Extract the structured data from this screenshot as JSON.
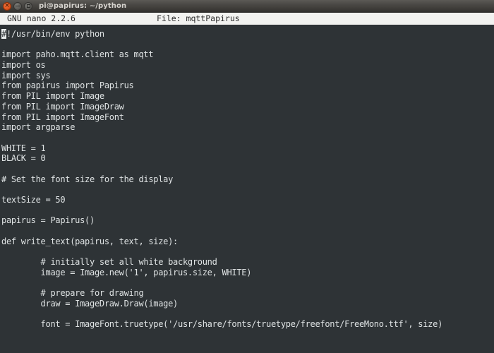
{
  "window": {
    "title": "pi@papirus: ~/python",
    "buttons": [
      {
        "name": "close",
        "glyph": "×"
      },
      {
        "name": "minimize",
        "glyph": "−"
      },
      {
        "name": "maximize",
        "glyph": "□"
      }
    ]
  },
  "nano": {
    "version_label": "GNU nano 2.2.6",
    "file_label": "File: mqttPapirus"
  },
  "editor": {
    "cursor": {
      "line": 0,
      "column": 0,
      "char": "#"
    },
    "lines": [
      "#!/usr/bin/env python",
      "",
      "import paho.mqtt.client as mqtt",
      "import os",
      "import sys",
      "from papirus import Papirus",
      "from PIL import Image",
      "from PIL import ImageDraw",
      "from PIL import ImageFont",
      "import argparse",
      "",
      "WHITE = 1",
      "BLACK = 0",
      "",
      "# Set the font size for the display",
      "",
      "textSize = 50",
      "",
      "papirus = Papirus()",
      "",
      "def write_text(papirus, text, size):",
      "",
      "        # initially set all white background",
      "        image = Image.new('1', papirus.size, WHITE)",
      "",
      "        # prepare for drawing",
      "        draw = ImageDraw.Draw(image)",
      "",
      "        font = ImageFont.truetype('/usr/share/fonts/truetype/freefont/FreeMono.ttf', size)",
      "",
      ""
    ]
  },
  "colors": {
    "terminal_background": "#2e3336",
    "terminal_foreground": "#dfe3e4",
    "header_background": "#f2f2f0",
    "header_foreground": "#2b2b2b",
    "titlebar_foreground": "#d7d4cf",
    "close_button": "#e1571f"
  }
}
